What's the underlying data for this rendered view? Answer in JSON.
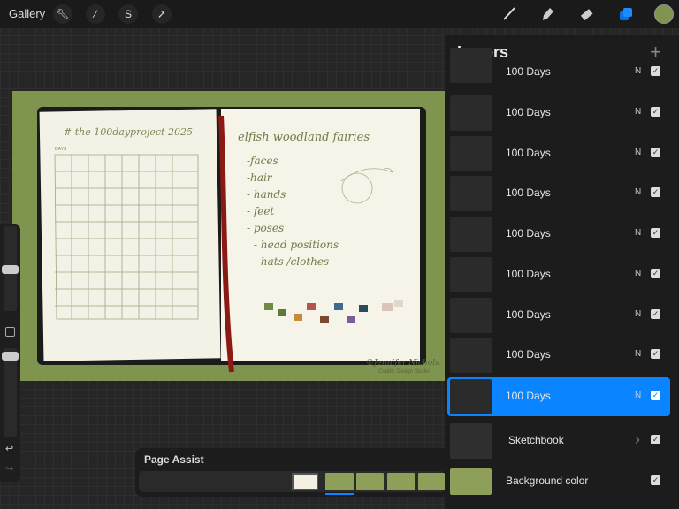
{
  "topbar": {
    "gallery": "Gallery",
    "tools_left": [
      "wrench-icon",
      "magic-wand-icon",
      "selection-icon",
      "transform-arrow-icon"
    ],
    "tools_right": [
      "brush-icon",
      "smudge-icon",
      "eraser-icon",
      "layers-icon",
      "color-swatch"
    ],
    "current_color": "#7f944e",
    "accent": "#0a84ff"
  },
  "artwork": {
    "left_page_title": "# the 100dayproject 2025",
    "left_page_small": "DAYS",
    "right_page_title": "elfish woodland fairies",
    "right_page_list": [
      "-faces",
      "-hair",
      "- hands",
      "- feet",
      "- poses",
      "- head positions",
      "- hats /clothes"
    ],
    "signature": "©Jennifer Nichols",
    "signature_sub": "Cuddly Design Studio"
  },
  "layers": {
    "title": "Layers",
    "add": "+",
    "items": [
      {
        "label": "100 Days",
        "blend": "N",
        "visible": true,
        "selected": false
      },
      {
        "label": "100 Days",
        "blend": "N",
        "visible": true,
        "selected": false
      },
      {
        "label": "100 Days",
        "blend": "N",
        "visible": true,
        "selected": false
      },
      {
        "label": "100 Days",
        "blend": "N",
        "visible": true,
        "selected": false
      },
      {
        "label": "100 Days",
        "blend": "N",
        "visible": true,
        "selected": false
      },
      {
        "label": "100 Days",
        "blend": "N",
        "visible": true,
        "selected": false
      },
      {
        "label": "100 Days",
        "blend": "N",
        "visible": true,
        "selected": false
      },
      {
        "label": "100 Days",
        "blend": "N",
        "visible": true,
        "selected": false
      },
      {
        "label": "100 Days",
        "blend": "N",
        "visible": true,
        "selected": true
      }
    ],
    "group": {
      "label": "Sketchbook",
      "chevron": "›"
    },
    "background": {
      "label": "Background color",
      "color": "#8e9f5a"
    }
  },
  "page_assist": {
    "title": "Page Assist",
    "active_page": 2,
    "pages": 5
  }
}
